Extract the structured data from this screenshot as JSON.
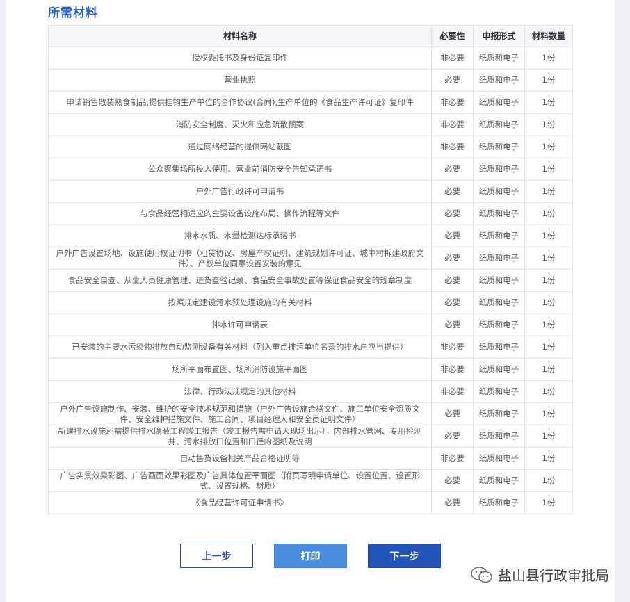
{
  "section": {
    "title": "所需材料"
  },
  "table": {
    "headers": {
      "name": "材料名称",
      "required": "必要性",
      "form": "申报形式",
      "quantity": "材料数量"
    },
    "rows": [
      {
        "name": "授权委托书及身份证复印件",
        "required": "非必要",
        "form": "纸质和电子",
        "quantity": "1份"
      },
      {
        "name": "营业执照",
        "required": "必要",
        "form": "纸质和电子",
        "quantity": "1份"
      },
      {
        "name": "申请销售散装熟食制品,提供挂钩生产单位的合作协议(合同),生产单位的《食品生产许可证》复印件",
        "required": "非必要",
        "form": "纸质和电子",
        "quantity": "1份"
      },
      {
        "name": "消防安全制度、灭火和应急疏散预案",
        "required": "非必要",
        "form": "纸质和电子",
        "quantity": "1份"
      },
      {
        "name": "通过网络经营的提供网站截图",
        "required": "非必要",
        "form": "纸质和电子",
        "quantity": "1份"
      },
      {
        "name": "公众聚集场所投入使用、营业前消防安全告知承诺书",
        "required": "必要",
        "form": "纸质和电子",
        "quantity": "1份"
      },
      {
        "name": "户外广告行政许可申请书",
        "required": "必要",
        "form": "纸质和电子",
        "quantity": "1份"
      },
      {
        "name": "与食品经营相适应的主要设备设施布局、操作流程等文件",
        "required": "必要",
        "form": "纸质和电子",
        "quantity": "1份"
      },
      {
        "name": "排水水质、水量检测达标承诺书",
        "required": "必要",
        "form": "纸质和电子",
        "quantity": "1份"
      },
      {
        "name": "户外广告设置场地、设施使用权证明书（租赁协议、房屋产权证明、建筑规划许可证、城中村拆建政府文件）、产权单位同意设置安装的意见",
        "required": "必要",
        "form": "纸质和电子",
        "quantity": "1份"
      },
      {
        "name": "食品安全自查、从业人员健康管理、进货查验记录、食品安全事故处置等保证食品安全的规章制度",
        "required": "必要",
        "form": "纸质和电子",
        "quantity": "1份"
      },
      {
        "name": "按照规定建设污水预处理设施的有关材料",
        "required": "必要",
        "form": "纸质和电子",
        "quantity": "1份"
      },
      {
        "name": "排水许可申请表",
        "required": "必要",
        "form": "纸质和电子",
        "quantity": "1份"
      },
      {
        "name": "已安装的主要水污染物排放自动监测设备有关材料（列入重点排污单位名录的排水户应当提供）",
        "required": "非必要",
        "form": "纸质和电子",
        "quantity": "1份"
      },
      {
        "name": "场所平面布置图、场所消防设施平面图",
        "required": "非必要",
        "form": "纸质和电子",
        "quantity": "1份"
      },
      {
        "name": "法律、行政法规规定的其他材料",
        "required": "非必要",
        "form": "纸质和电子",
        "quantity": "1份"
      },
      {
        "name": "户外广告设施制作、安装、维护的安全技术规范和措施（户外广告设施合格文件、施工单位安全资质文件、安全维护措施文件、施工合同、项目经理人和安全员证明文件）",
        "required": "必要",
        "form": "纸质和电子",
        "quantity": "1份"
      },
      {
        "name": "新建排水设施还需提供排水隐蔽工程竣工报告（竣工报告需申请人现场出示），内部排水管网、专用检测井、污水排放口位置和口径的图纸及说明",
        "required": "必要",
        "form": "纸质和电子",
        "quantity": "1份"
      },
      {
        "name": "自动售货设备相关产品合格证明等",
        "required": "非必要",
        "form": "纸质和电子",
        "quantity": "1份"
      },
      {
        "name": "广告实景效果彩图、广告画面效果彩图及广告具体位置平面图（附页写明申请单位、设置位置、设置形式、设置规格、材质）",
        "required": "必要",
        "form": "纸质和电子",
        "quantity": "1份"
      },
      {
        "name": "《食品经营许可证申请书》",
        "required": "必要",
        "form": "纸质和电子",
        "quantity": "1份"
      }
    ]
  },
  "buttons": {
    "prev": "上一步",
    "print": "打印",
    "next": "下一步"
  },
  "watermark": {
    "text": "盐山县行政审批局",
    "icon": "wechat-icon"
  },
  "colors": {
    "title": "#2b5fbf",
    "print_button": "#4a8ee0",
    "next_button": "#2354b8",
    "prev_border": "#2b4f9e"
  }
}
